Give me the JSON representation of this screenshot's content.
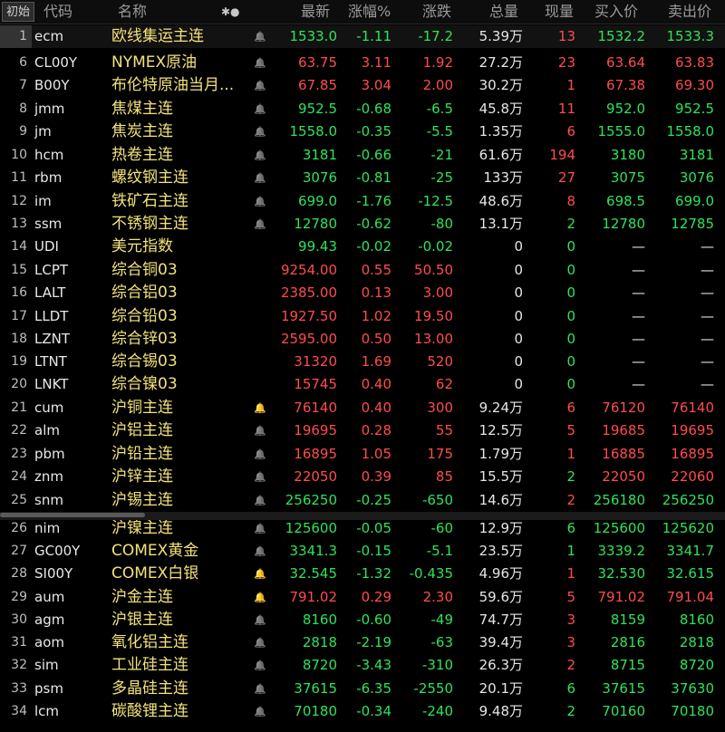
{
  "header": {
    "init_button": "初始",
    "col_code": "代码",
    "col_name": "名称",
    "star_dots": "✱●",
    "col_last": "最新",
    "col_pct": "涨幅%",
    "col_chg": "涨跌",
    "col_vol": "总量",
    "col_cur": "现量",
    "col_bid": "买入价",
    "col_ask": "卖出价"
  },
  "colors": {
    "up": "#ff4c4c",
    "down": "#2ee35a",
    "name": "#f2e27a"
  },
  "rows": [
    {
      "idx": "1",
      "code": "ecm",
      "name": "欧线集运主连",
      "bell": "off",
      "last": "1533.0",
      "pct": "-1.11",
      "chg": "-17.2",
      "vol": "5.39万",
      "cur": "13",
      "bid": "1532.2",
      "ask": "1533.3",
      "dir": "down",
      "curdir": "red"
    },
    {
      "idx": "6",
      "code": "CL00Y",
      "name": "NYMEX原油",
      "bell": "off",
      "last": "63.75",
      "pct": "3.11",
      "chg": "1.92",
      "vol": "27.2万",
      "cur": "23",
      "bid": "63.64",
      "ask": "63.83",
      "dir": "up",
      "curdir": "red"
    },
    {
      "idx": "7",
      "code": "B00Y",
      "name": "布伦特原油当月...",
      "bell": "off",
      "last": "67.85",
      "pct": "3.04",
      "chg": "2.00",
      "vol": "30.2万",
      "cur": "1",
      "bid": "67.38",
      "ask": "69.30",
      "dir": "up",
      "curdir": "red"
    },
    {
      "idx": "8",
      "code": "jmm",
      "name": "焦煤主连",
      "bell": "off",
      "last": "952.5",
      "pct": "-0.68",
      "chg": "-6.5",
      "vol": "45.8万",
      "cur": "11",
      "bid": "952.0",
      "ask": "952.5",
      "dir": "down",
      "curdir": "red"
    },
    {
      "idx": "9",
      "code": "jm",
      "name": "焦炭主连",
      "bell": "off",
      "last": "1558.0",
      "pct": "-0.35",
      "chg": "-5.5",
      "vol": "1.35万",
      "cur": "6",
      "bid": "1555.0",
      "ask": "1558.0",
      "dir": "down",
      "curdir": "red"
    },
    {
      "idx": "10",
      "code": "hcm",
      "name": "热卷主连",
      "bell": "off",
      "last": "3181",
      "pct": "-0.66",
      "chg": "-21",
      "vol": "61.6万",
      "cur": "194",
      "bid": "3180",
      "ask": "3181",
      "dir": "down",
      "curdir": "red"
    },
    {
      "idx": "11",
      "code": "rbm",
      "name": "螺纹钢主连",
      "bell": "off",
      "last": "3076",
      "pct": "-0.81",
      "chg": "-25",
      "vol": "133万",
      "cur": "27",
      "bid": "3075",
      "ask": "3076",
      "dir": "down",
      "curdir": "red"
    },
    {
      "idx": "12",
      "code": "im",
      "name": "铁矿石主连",
      "bell": "off",
      "last": "699.0",
      "pct": "-1.76",
      "chg": "-12.5",
      "vol": "48.6万",
      "cur": "8",
      "bid": "698.5",
      "ask": "699.0",
      "dir": "down",
      "curdir": "red"
    },
    {
      "idx": "13",
      "code": "ssm",
      "name": "不锈钢主连",
      "bell": "off",
      "last": "12780",
      "pct": "-0.62",
      "chg": "-80",
      "vol": "13.1万",
      "cur": "2",
      "bid": "12780",
      "ask": "12785",
      "dir": "down",
      "curdir": "green"
    },
    {
      "idx": "14",
      "code": "UDI",
      "name": "美元指数",
      "bell": "none",
      "last": "99.43",
      "pct": "-0.02",
      "chg": "-0.02",
      "vol": "0",
      "cur": "0",
      "bid": "—",
      "ask": "—",
      "dir": "down",
      "curdir": "green",
      "plain": true
    },
    {
      "idx": "15",
      "code": "LCPT",
      "name": "综合铜03",
      "bell": "none",
      "last": "9254.00",
      "pct": "0.55",
      "chg": "50.50",
      "vol": "0",
      "cur": "0",
      "bid": "—",
      "ask": "—",
      "dir": "up",
      "curdir": "green",
      "plain": true
    },
    {
      "idx": "16",
      "code": "LALT",
      "name": "综合铝03",
      "bell": "none",
      "last": "2385.00",
      "pct": "0.13",
      "chg": "3.00",
      "vol": "0",
      "cur": "0",
      "bid": "—",
      "ask": "—",
      "dir": "up",
      "curdir": "green",
      "plain": true
    },
    {
      "idx": "17",
      "code": "LLDT",
      "name": "综合铅03",
      "bell": "none",
      "last": "1927.50",
      "pct": "1.02",
      "chg": "19.50",
      "vol": "0",
      "cur": "0",
      "bid": "—",
      "ask": "—",
      "dir": "up",
      "curdir": "green",
      "plain": true
    },
    {
      "idx": "18",
      "code": "LZNT",
      "name": "综合锌03",
      "bell": "none",
      "last": "2595.00",
      "pct": "0.50",
      "chg": "13.00",
      "vol": "0",
      "cur": "0",
      "bid": "—",
      "ask": "—",
      "dir": "up",
      "curdir": "green",
      "plain": true
    },
    {
      "idx": "19",
      "code": "LTNT",
      "name": "综合锡03",
      "bell": "none",
      "last": "31320",
      "pct": "1.69",
      "chg": "520",
      "vol": "0",
      "cur": "0",
      "bid": "—",
      "ask": "—",
      "dir": "up",
      "curdir": "green",
      "plain": true
    },
    {
      "idx": "20",
      "code": "LNKT",
      "name": "综合镍03",
      "bell": "none",
      "last": "15745",
      "pct": "0.40",
      "chg": "62",
      "vol": "0",
      "cur": "0",
      "bid": "—",
      "ask": "—",
      "dir": "up",
      "curdir": "green",
      "plain": true
    },
    {
      "idx": "21",
      "code": "cum",
      "name": "沪铜主连",
      "bell": "active",
      "last": "76140",
      "pct": "0.40",
      "chg": "300",
      "vol": "9.24万",
      "cur": "6",
      "bid": "76120",
      "ask": "76140",
      "dir": "up",
      "curdir": "red"
    },
    {
      "idx": "22",
      "code": "alm",
      "name": "沪铝主连",
      "bell": "off",
      "last": "19695",
      "pct": "0.28",
      "chg": "55",
      "vol": "12.5万",
      "cur": "5",
      "bid": "19685",
      "ask": "19695",
      "dir": "up",
      "curdir": "red"
    },
    {
      "idx": "23",
      "code": "pbm",
      "name": "沪铅主连",
      "bell": "off",
      "last": "16895",
      "pct": "1.05",
      "chg": "175",
      "vol": "1.79万",
      "cur": "1",
      "bid": "16885",
      "ask": "16895",
      "dir": "up",
      "curdir": "red"
    },
    {
      "idx": "24",
      "code": "znm",
      "name": "沪锌主连",
      "bell": "off",
      "last": "22050",
      "pct": "0.39",
      "chg": "85",
      "vol": "15.5万",
      "cur": "2",
      "bid": "22050",
      "ask": "22060",
      "dir": "up",
      "curdir": "green"
    },
    {
      "idx": "25",
      "code": "snm",
      "name": "沪锡主连",
      "bell": "off",
      "last": "256250",
      "pct": "-0.25",
      "chg": "-650",
      "vol": "14.6万",
      "cur": "2",
      "bid": "256180",
      "ask": "256250",
      "dir": "down",
      "curdir": "red"
    },
    {
      "idx": "26",
      "code": "nim",
      "name": "沪镍主连",
      "bell": "off",
      "last": "125600",
      "pct": "-0.05",
      "chg": "-60",
      "vol": "12.9万",
      "cur": "6",
      "bid": "125600",
      "ask": "125620",
      "dir": "down",
      "curdir": "green"
    },
    {
      "idx": "27",
      "code": "GC00Y",
      "name": "COMEX黄金",
      "bell": "off",
      "last": "3341.3",
      "pct": "-0.15",
      "chg": "-5.1",
      "vol": "23.5万",
      "cur": "1",
      "bid": "3339.2",
      "ask": "3341.7",
      "dir": "down",
      "curdir": "green"
    },
    {
      "idx": "28",
      "code": "SI00Y",
      "name": "COMEX白银",
      "bell": "active",
      "last": "32.545",
      "pct": "-1.32",
      "chg": "-0.435",
      "vol": "4.96万",
      "cur": "1",
      "bid": "32.530",
      "ask": "32.615",
      "dir": "down",
      "curdir": "red"
    },
    {
      "idx": "29",
      "code": "aum",
      "name": "沪金主连",
      "bell": "active",
      "last": "791.02",
      "pct": "0.29",
      "chg": "2.30",
      "vol": "59.6万",
      "cur": "5",
      "bid": "791.02",
      "ask": "791.04",
      "dir": "up",
      "curdir": "red"
    },
    {
      "idx": "30",
      "code": "agm",
      "name": "沪银主连",
      "bell": "off",
      "last": "8160",
      "pct": "-0.60",
      "chg": "-49",
      "vol": "74.7万",
      "cur": "3",
      "bid": "8159",
      "ask": "8160",
      "dir": "down",
      "curdir": "red"
    },
    {
      "idx": "31",
      "code": "aom",
      "name": "氧化铝主连",
      "bell": "off",
      "last": "2818",
      "pct": "-2.19",
      "chg": "-63",
      "vol": "39.4万",
      "cur": "3",
      "bid": "2816",
      "ask": "2818",
      "dir": "down",
      "curdir": "red"
    },
    {
      "idx": "32",
      "code": "sim",
      "name": "工业硅主连",
      "bell": "off",
      "last": "8720",
      "pct": "-3.43",
      "chg": "-310",
      "vol": "26.3万",
      "cur": "2",
      "bid": "8715",
      "ask": "8720",
      "dir": "down",
      "curdir": "red"
    },
    {
      "idx": "33",
      "code": "psm",
      "name": "多晶硅主连",
      "bell": "off",
      "last": "37615",
      "pct": "-6.35",
      "chg": "-2550",
      "vol": "20.1万",
      "cur": "6",
      "bid": "37615",
      "ask": "37630",
      "dir": "down",
      "curdir": "green"
    },
    {
      "idx": "34",
      "code": "lcm",
      "name": "碳酸锂主连",
      "bell": "off",
      "last": "70180",
      "pct": "-0.34",
      "chg": "-240",
      "vol": "9.48万",
      "cur": "2",
      "bid": "70160",
      "ask": "70180",
      "dir": "down",
      "curdir": "green"
    }
  ]
}
